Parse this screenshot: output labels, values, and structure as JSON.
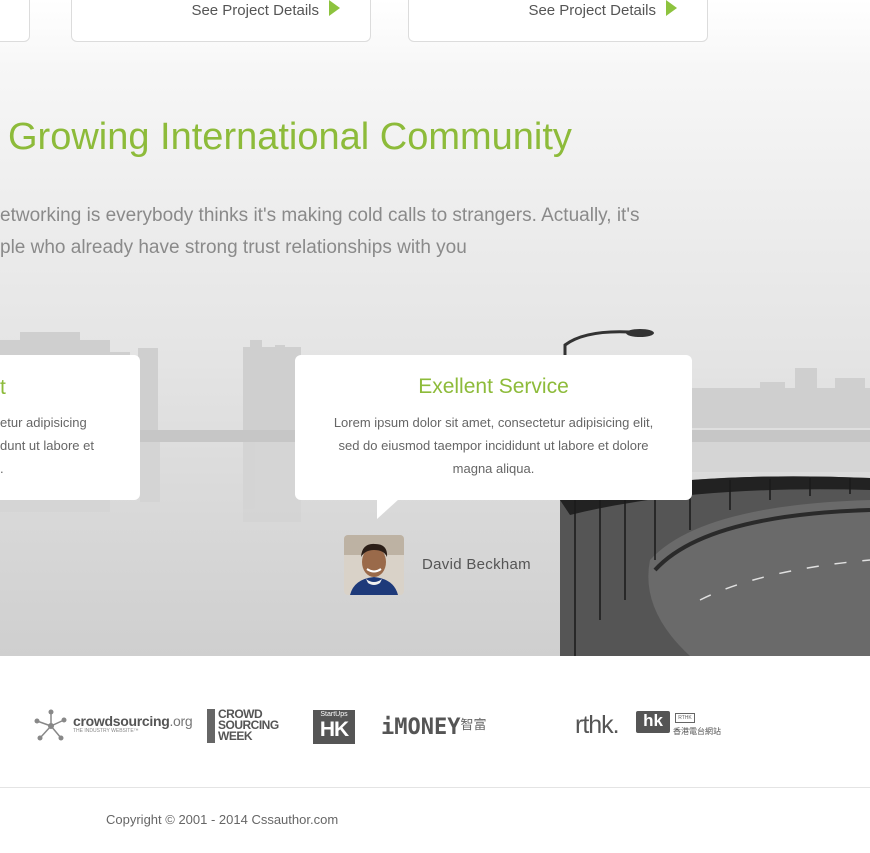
{
  "projects": [
    {
      "link_label": "See Project Details"
    },
    {
      "link_label": "See Project Details"
    }
  ],
  "community": {
    "heading": "Growing International Community",
    "intro_line1": "etworking is everybody thinks it's making cold calls to strangers. Actually, it's",
    "intro_line2": "ple who already have strong trust relationships with you"
  },
  "testimonials": {
    "left": {
      "title": "t",
      "text_line1": "etur adipisicing",
      "text_line2": "dunt ut labore et",
      "text_line3": "."
    },
    "main": {
      "title": "Exellent Service",
      "text": "Lorem ipsum dolor sit amet, consectetur adipisicing elit, sed do eiusmod taempor incididunt ut labore et dolore magna aliqua."
    },
    "author": "David Beckham"
  },
  "partners": {
    "crowdsourcing": {
      "name": "crowdsourcing",
      "suffix": ".org",
      "tagline": "THE INDUSTRY WEBSITE™"
    },
    "csweek": {
      "line1": "CROWD",
      "line2": "SOURCING",
      "line3": "WEEK"
    },
    "startups_hk": {
      "small": "StartUps",
      "big": "HK"
    },
    "imoney": {
      "name": "iMONEY",
      "cn": "智富"
    },
    "rthk": {
      "name": "rthk.",
      "hk": "hk",
      "radio": "RTHK",
      "cn": "香港電台網站"
    }
  },
  "footer": {
    "copyright": "Copyright © 2001 - 2014  Cssauthor.com"
  },
  "colors": {
    "accent": "#8dbb3a",
    "play_icon": "#8dc33e",
    "text_muted": "#8a8a8a"
  }
}
